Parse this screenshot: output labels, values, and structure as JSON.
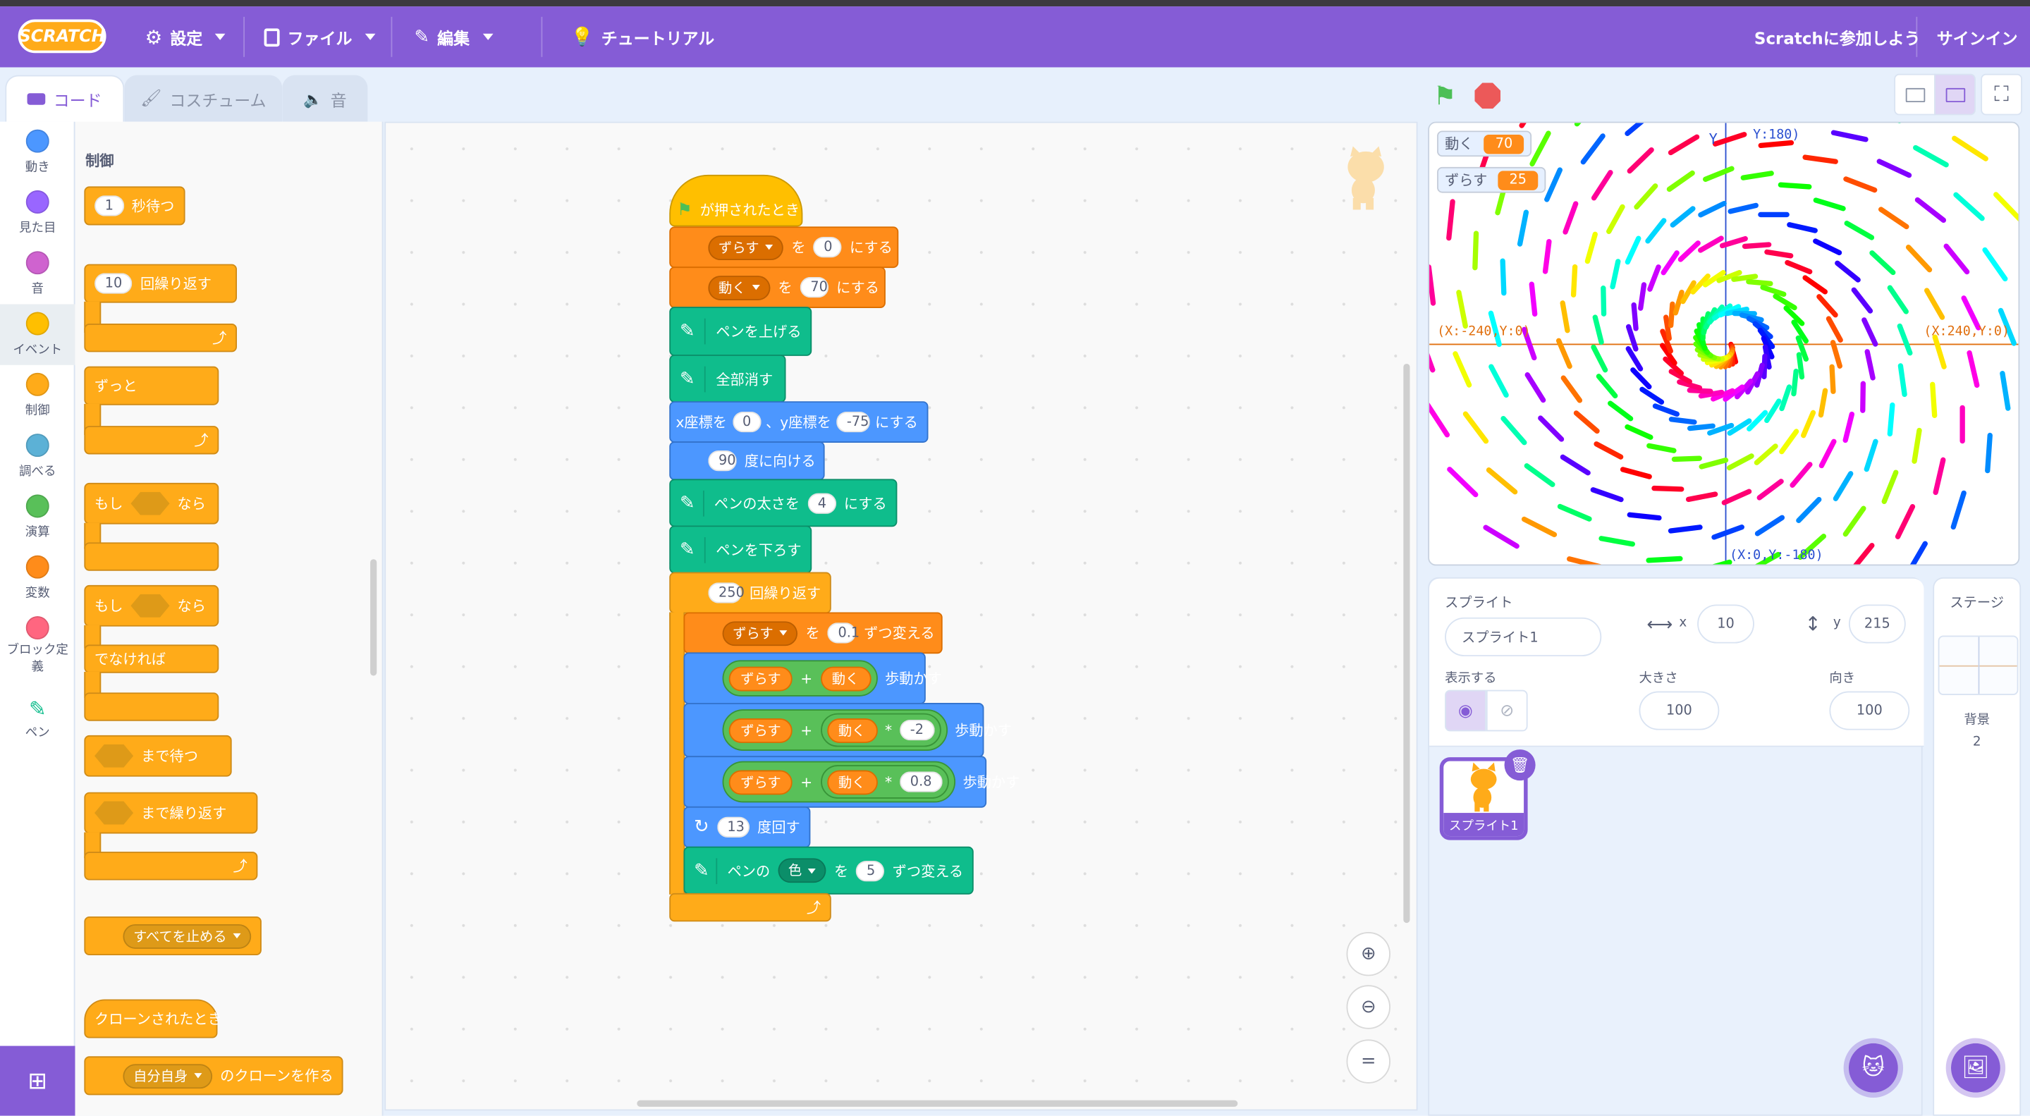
{
  "menubar": {
    "logo": "SCRATCH",
    "settings": "設定",
    "file": "ファイル",
    "edit": "編集",
    "tutorials": "チュートリアル",
    "join": "Scratchに参加しよう",
    "signin": "サインイン"
  },
  "tabs": [
    "コード",
    "コスチューム",
    "音"
  ],
  "categories": [
    {
      "label": "動き",
      "color": "#4c97ff"
    },
    {
      "label": "見た目",
      "color": "#9966ff"
    },
    {
      "label": "音",
      "color": "#cf63cf"
    },
    {
      "label": "イベント",
      "color": "#ffbf00"
    },
    {
      "label": "制御",
      "color": "#ffab19"
    },
    {
      "label": "調べる",
      "color": "#5cb1d6"
    },
    {
      "label": "演算",
      "color": "#59c059"
    },
    {
      "label": "変数",
      "color": "#ff8c1a"
    },
    {
      "label": "ブロック定義",
      "color": "#ff6680"
    },
    {
      "label": "ペン",
      "color": "#0fbd8c"
    }
  ],
  "palette": {
    "heading": "制御",
    "wait_val": "1",
    "wait": "秒待つ",
    "repeat_val": "10",
    "repeat": "回繰り返す",
    "forever": "ずっと",
    "if": "もし",
    "then": "なら",
    "else": "でなければ",
    "wait_until": "まで待つ",
    "repeat_until": "まで繰り返す",
    "stop": "すべてを止める",
    "clone_start": "クローンされたとき",
    "clone_target": "自分自身",
    "create_clone": "のクローンを作る"
  },
  "script": {
    "hat": "が押されたとき",
    "set1_var": "ずらす",
    "wo": "を",
    "set1_val": "0",
    "set_suffix": "にする",
    "set2_var": "動く",
    "set2_val": "70",
    "pen_up": "ペンを上げる",
    "clear": "全部消す",
    "goto_x_label": "x座標を",
    "goto_x": "0",
    "goto_y_label": "、y座標を",
    "goto_y": "-75",
    "goto_suffix": "にする",
    "point_val": "90",
    "point": "度に向ける",
    "pen_size_label": "ペンの太さを",
    "pen_size": "4",
    "pen_size_suffix": "にする",
    "pen_down": "ペンを下ろす",
    "repeat_val": "250",
    "repeat": "回繰り返す",
    "change_var": "ずらす",
    "change_val": "0.1",
    "change_suffix": "ずつ変える",
    "op_a": "ずらす",
    "plus": "+",
    "op_b": "動く",
    "times": "*",
    "mul1": "-2",
    "mul2": "0.8",
    "move": "歩動かす",
    "turn_val": "13",
    "turn": "度回す",
    "pen_color_label": "ペンの",
    "pen_color_param": "色",
    "pen_color_val": "5",
    "pen_color_suffix": "ずつ変える"
  },
  "monitors": [
    {
      "name": "動く",
      "value": "70"
    },
    {
      "name": "ずらす",
      "value": "25"
    }
  ],
  "stage_labels": {
    "y_axis": "Y",
    "left": "(X:-240,Y:0)",
    "right": "(X:240,Y:0)",
    "bottom": "(X:0,Y:-180)",
    "top": "Y:180)"
  },
  "sprite_info": {
    "sprite_label": "スプライト",
    "sprite_name": "スプライト1",
    "x_label": "x",
    "x_val": "10",
    "y_label": "y",
    "y_val": "215",
    "show_label": "表示する",
    "size_label": "大きさ",
    "size_val": "100",
    "dir_label": "向き",
    "dir_val": "100",
    "thumb_name": "スプライト1"
  },
  "stage_pane": {
    "title": "ステージ",
    "backdrop_label": "背景",
    "backdrop_count": "2"
  },
  "zoom": {
    "reset": "="
  }
}
